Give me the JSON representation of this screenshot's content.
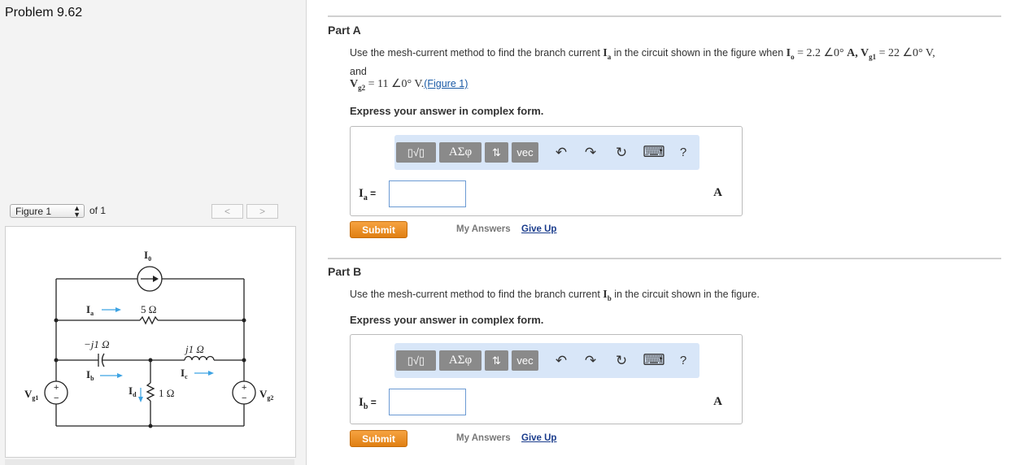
{
  "problem_title": "Problem 9.62",
  "figure_nav": {
    "select_value": "Figure 1",
    "of_label": "of 1",
    "prev": "<",
    "next": ">"
  },
  "circuit": {
    "Io": "I",
    "Io_sub": "0",
    "Ia": "I",
    "Ia_sub": "a",
    "Ib": "I",
    "Ib_sub": "b",
    "Ic": "I",
    "Ic_sub": "c",
    "Id": "I",
    "Id_sub": "d",
    "r5": "5 Ω",
    "cap": "−j1 Ω",
    "ind": "j1 Ω",
    "r1": "1 Ω",
    "Vg1": "V",
    "Vg1_sub": "g1",
    "Vg2": "V",
    "Vg2_sub": "g2",
    "plus": "+",
    "minus": "−"
  },
  "partA": {
    "heading": "Part A",
    "q_line1_pre": "Use the mesh-current method to find the branch current ",
    "q_Ia": "I",
    "q_Ia_sub": "a",
    "q_line1_mid": " in the circuit shown in the figure when ",
    "q_Io": "I",
    "q_Io_sub": "o",
    "q_eq1": " = 2.2 ∠0° ",
    "q_A": "A, V",
    "q_g1": "g1",
    "q_eq2": " = 22 ∠0° V,",
    "q_and": "and",
    "q_V2": "V",
    "q_g2": "g2",
    "q_eq3": " = 11 ∠0° V.",
    "q_figlink": "(Figure 1)",
    "express": "Express your answer in complex form.",
    "answer_label": "I",
    "answer_label_sub": "a",
    "answer_eq": " =",
    "unit": "A",
    "submit": "Submit",
    "my_answers": "My Answers",
    "give_up": "Give Up"
  },
  "partB": {
    "heading": "Part B",
    "q_pre": "Use the mesh-current method to find the branch current ",
    "q_Ib": "I",
    "q_Ib_sub": "b",
    "q_post": " in the circuit shown in the figure.",
    "express": "Express your answer in complex form.",
    "answer_label": "I",
    "answer_label_sub": "b",
    "answer_eq": " =",
    "unit": "A",
    "submit": "Submit",
    "my_answers": "My Answers",
    "give_up": "Give Up"
  },
  "toolbar": {
    "template_glyph": "▯√▯",
    "greek": "ΑΣφ",
    "arrows": "⇅",
    "vec": "vec",
    "undo": "↶",
    "redo": "↷",
    "reset": "↻",
    "keyboard": "⌨",
    "help": "?"
  }
}
